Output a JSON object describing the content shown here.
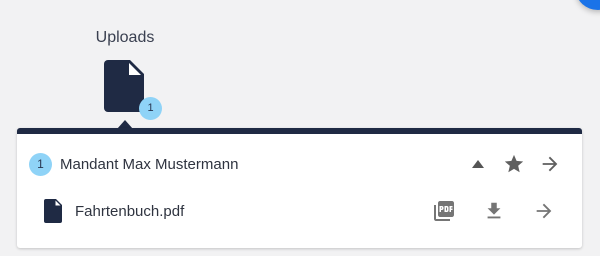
{
  "uploads": {
    "title": "Uploads",
    "count": "1",
    "icon": "file-icon"
  },
  "group": {
    "count": "1",
    "label": "Mandant Max Mustermann",
    "actions": {
      "collapse_icon": "triangle-up-icon",
      "favorite_icon": "star-icon",
      "open_icon": "arrow-right-icon"
    }
  },
  "files": [
    {
      "name": "Fahrtenbuch.pdf",
      "icon": "file-icon",
      "actions": {
        "pdf_icon": "pdf-icon",
        "download_icon": "download-icon",
        "open_icon": "arrow-right-icon"
      }
    }
  ],
  "colors": {
    "background": "#f2f2f3",
    "panel_border": "#1f2a44",
    "badge": "#8fd3f7",
    "icon_gray": "#757575",
    "fab": "#1a73e8"
  }
}
